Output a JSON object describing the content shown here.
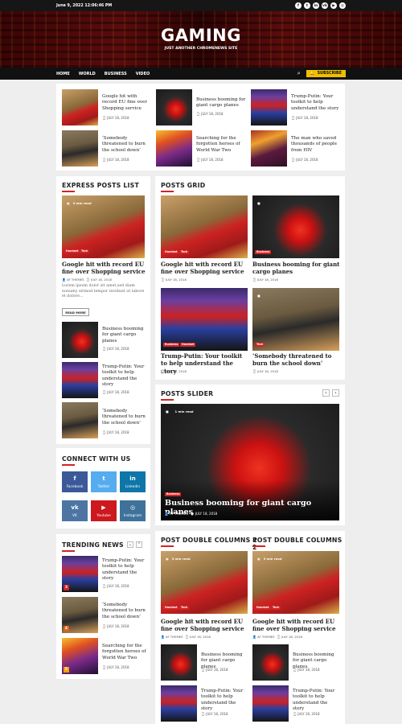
{
  "topbar": {
    "datetime": "June 9, 2022 12:06:46 PM",
    "social_icons": [
      "facebook-icon",
      "twitter-icon",
      "linkedin-icon",
      "vk-icon",
      "youtube-icon",
      "instagram-icon"
    ]
  },
  "site": {
    "title": "GAMING",
    "tagline": "JUST ANOTHER CHROMENEWS SITE"
  },
  "nav": {
    "items": [
      "HOME",
      "WORLD",
      "BUSINESS",
      "VIDEO"
    ],
    "subscribe": "SUBSCRIBE"
  },
  "date": "JULY 18, 2018",
  "author": "AF THEMES",
  "headlines": [
    "Google hit with record EU fine over Shopping service",
    "Business booming for giant cargo planes",
    "Trump-Putin: Your toolkit to help understand the story",
    "‘Somebody threatened to burn the school down’",
    "Searching for the forgotten heroes of World War Two",
    "The man who saved thousands of people from HIV"
  ],
  "express": {
    "title": "EXPRESS POSTS LIST",
    "read_time": "3 min read",
    "tags": [
      "Handset",
      "Tech"
    ],
    "excerpt": "Lorem ipsum dolor sit amet,sed diam nonumy eirmod tempor invidunt ut labore et dolore...",
    "read_more": "READ MORE"
  },
  "grid": {
    "title": "POSTS GRID",
    "tags1": [
      "Handset",
      "Tech"
    ],
    "tags2": [
      "Business"
    ],
    "tags3": [
      "Business",
      "Handset"
    ],
    "tags4": [
      "Tech"
    ]
  },
  "connect": {
    "title": "CONNECT WITH US",
    "items": [
      {
        "label": "Facebook",
        "color": "#3b5998"
      },
      {
        "label": "Twitter",
        "color": "#55acee"
      },
      {
        "label": "Linkedin",
        "color": "#0e76a8"
      },
      {
        "label": "VK",
        "color": "#4c75a3"
      },
      {
        "label": "Youtube",
        "color": "#cc181e"
      },
      {
        "label": "Instagram",
        "color": "#3f729b"
      }
    ]
  },
  "slider": {
    "title": "POSTS SLIDER",
    "read_time": "1 min read",
    "tag": "Business",
    "headline": "Business booming for giant cargo planes"
  },
  "trending": {
    "title": "TRENDING NEWS",
    "nums": [
      "3",
      "4",
      "5"
    ],
    "colors": [
      "#d32323",
      "#e06020",
      "#f0a000"
    ]
  },
  "double": {
    "title1": "POST DOUBLE COLUMNS 1",
    "title2": "POST DOUBLE COLUMNS 2",
    "read_time": "3 min read",
    "tags": [
      "Handset",
      "Tech"
    ]
  }
}
